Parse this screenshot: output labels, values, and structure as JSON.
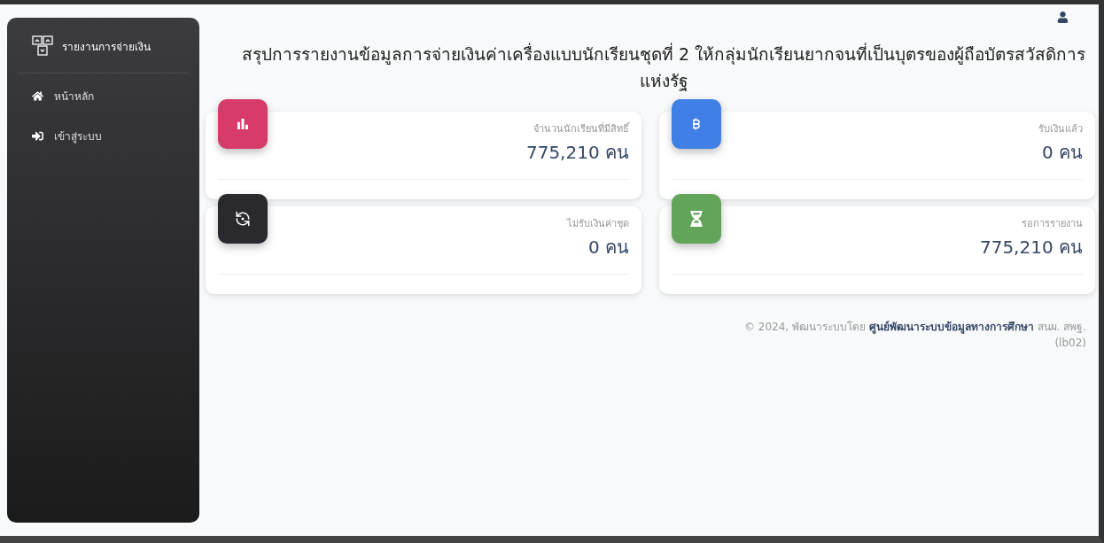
{
  "sidebar": {
    "brand": "รายงานการจ่ายเงิน",
    "items": [
      {
        "label": "หน้าหลัก",
        "kind": "home"
      },
      {
        "label": "เข้าสู่ระบบ",
        "kind": "login"
      }
    ]
  },
  "title": "สรุปการรายงานข้อมูลการจ่ายเงินค่าเครื่องแบบนักเรียนชุดที่ 2 ให้กลุ่มนักเรียนยากจนที่เป็นบุตรของผู้ถือบัตรสวัสดิการแห่งรัฐ",
  "cards": [
    {
      "label": "จำนวนนักเรียนที่มีสิทธิ์",
      "value": "775,210 คน",
      "kind": "chart",
      "color": "#d63b6a"
    },
    {
      "label": "รับเงินแล้ว",
      "value": "0 คน",
      "kind": "baht",
      "color": "#3f7fe6"
    },
    {
      "label": "ไม่รับเงินค่าชุด",
      "value": "0 คน",
      "kind": "refresh",
      "color": "#2a2a2e"
    },
    {
      "label": "รอการรายงาน",
      "value": "775,210 คน",
      "kind": "hourglass",
      "color": "#62a55a"
    }
  ],
  "footer": "© 2024, พัฒนาระบบโดย **ศูนย์พัฒนาระบบข้อมูลทางการศึกษา** สนผ. สพฐ. (lb02)"
}
